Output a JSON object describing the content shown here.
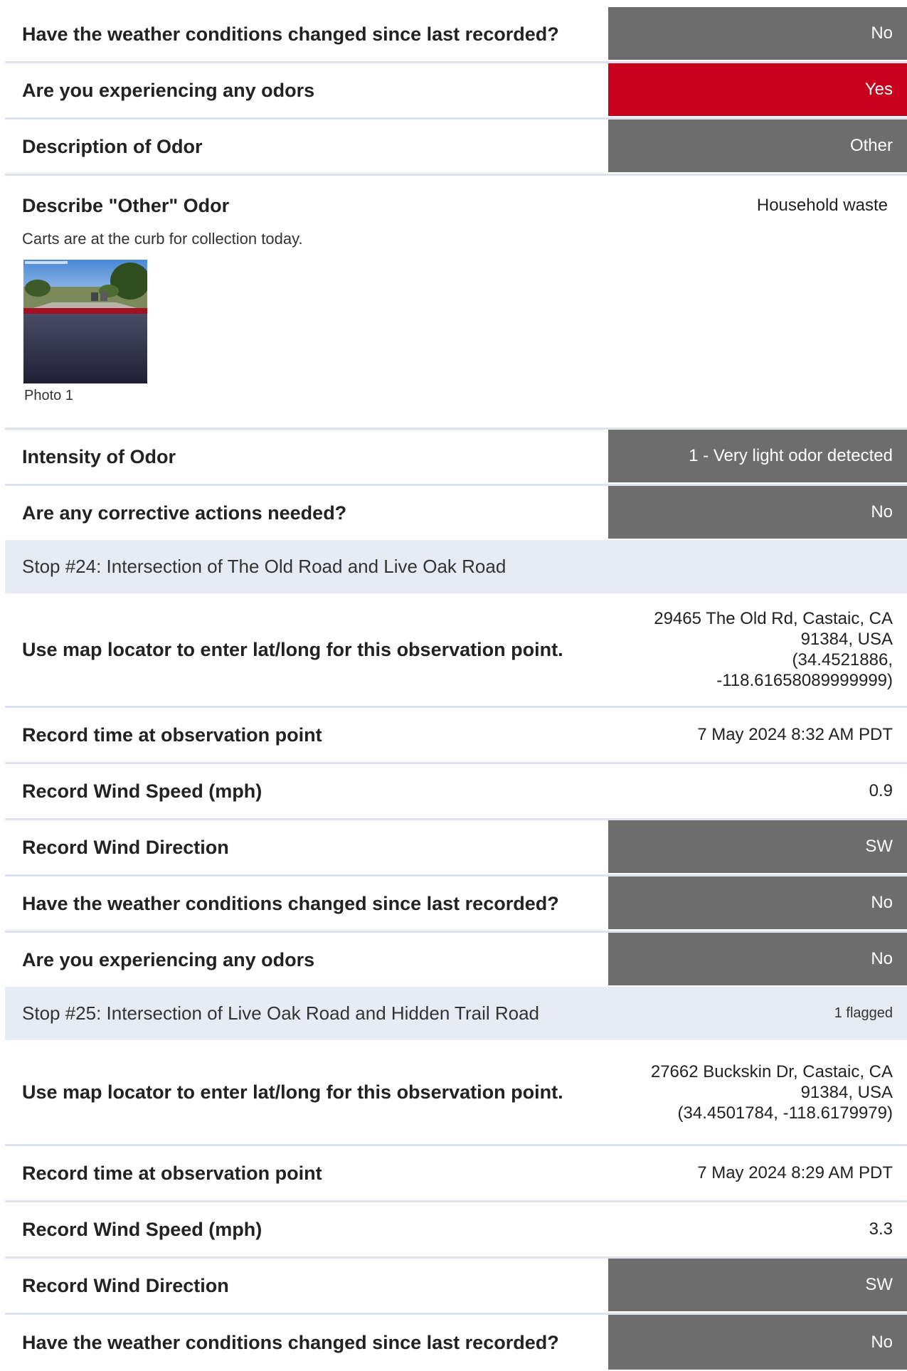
{
  "rows_a": [
    {
      "question": "Have the weather conditions changed since last recorded?",
      "answer": "No"
    },
    {
      "question": "Are you experiencing any odors",
      "answer": "Yes"
    },
    {
      "question": "Description of Odor",
      "answer": "Other"
    }
  ],
  "other_odor": {
    "question": "Describe \"Other\" Odor",
    "answer": "Household waste",
    "note": "Carts are at the curb for collection today.",
    "photo_caption": "Photo 1"
  },
  "rows_b": [
    {
      "question": "Intensity of Odor",
      "answer": "1 - Very light odor detected"
    },
    {
      "question": "Are any corrective actions needed?",
      "answer": "No"
    }
  ],
  "stop24": {
    "title": "Stop #24: Intersection of The Old Road and Live Oak Road",
    "rows": [
      {
        "question": "Use map locator to enter lat/long for this observation point.",
        "answer_lines": [
          "29465 The Old Rd, Castaic, CA",
          "91384, USA",
          "(34.4521886,",
          "-118.61658089999999)"
        ]
      },
      {
        "question": "Record time at observation point",
        "answer": "7 May 2024 8:32 AM PDT"
      },
      {
        "question": "Record Wind Speed (mph)",
        "answer": "0.9"
      },
      {
        "question": "Record Wind Direction",
        "answer": "SW"
      },
      {
        "question": "Have the weather conditions changed since last recorded?",
        "answer": "No"
      },
      {
        "question": "Are you experiencing any odors",
        "answer": "No"
      }
    ]
  },
  "stop25": {
    "title": "Stop #25: Intersection of Live Oak Road and Hidden Trail Road",
    "flagged": "1 flagged",
    "rows": [
      {
        "question": "Use map locator to enter lat/long for this observation point.",
        "answer_lines": [
          "27662 Buckskin Dr, Castaic, CA",
          "91384, USA",
          "(34.4501784, -118.6179979)"
        ]
      },
      {
        "question": "Record time at observation point",
        "answer": "7 May 2024 8:29 AM PDT"
      },
      {
        "question": "Record Wind Speed (mph)",
        "answer": "3.3"
      },
      {
        "question": "Record Wind Direction",
        "answer": "SW"
      },
      {
        "question": "Have the weather conditions changed since last recorded?",
        "answer": "No"
      }
    ]
  },
  "colors": {
    "answer_box": "#6d6d6d",
    "flagged_box": "#c8001e",
    "stop_header_bg": "#e7ebf4",
    "divider": "#dde2ec"
  }
}
